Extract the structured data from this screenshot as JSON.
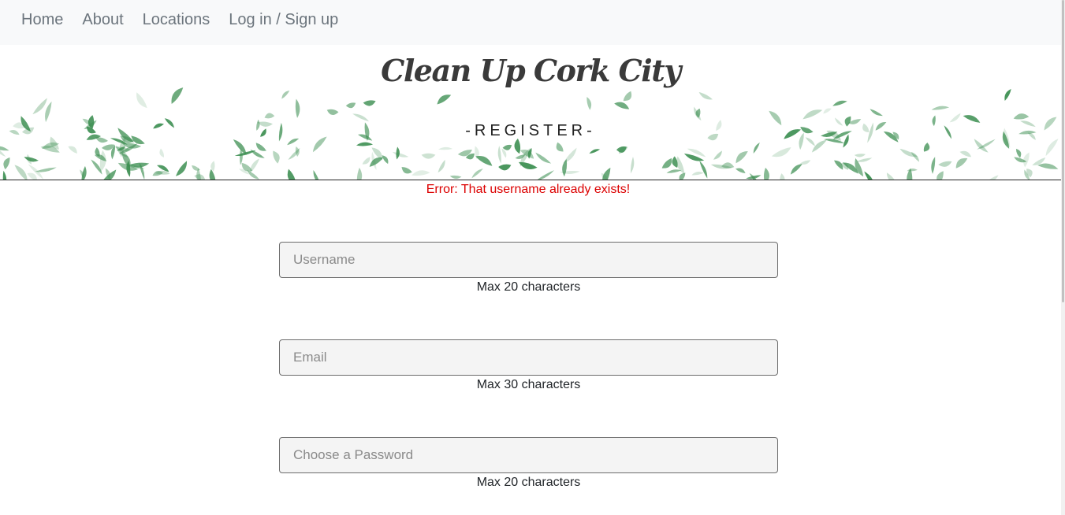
{
  "nav": {
    "home": "Home",
    "about": "About",
    "locations": "Locations",
    "login": "Log in / Sign up"
  },
  "header": {
    "site_title": "Clean Up Cork City",
    "page_heading": "-REGISTER-"
  },
  "error_message": "Error: That username already exists!",
  "form": {
    "username": {
      "placeholder": "Username",
      "value": "",
      "hint": "Max 20 characters"
    },
    "email": {
      "placeholder": "Email",
      "value": "",
      "hint": "Max 30 characters"
    },
    "password": {
      "placeholder": "Choose a Password",
      "value": "",
      "hint": "Max 20 characters"
    }
  },
  "colors": {
    "navbar_bg": "#f8f9fa",
    "nav_text": "#6c757d",
    "error": "#dc0000",
    "leaf_green": "#3d8f52",
    "input_bg": "#f4f4f4"
  },
  "icons": [
    "leaves-decoration"
  ]
}
